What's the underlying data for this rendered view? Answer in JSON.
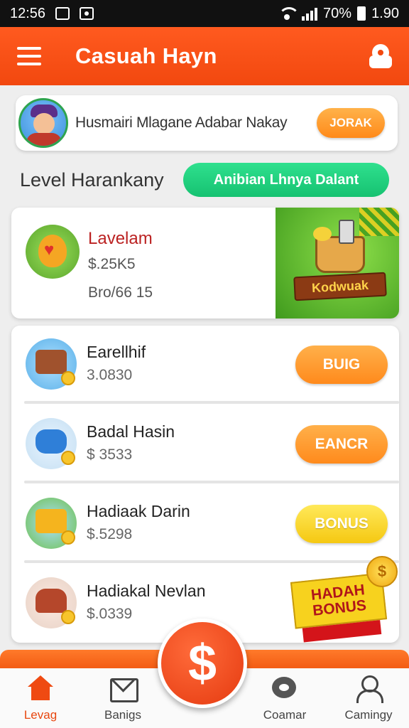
{
  "status_bar": {
    "time": "12:56",
    "battery_text": "70%",
    "clock_right": "1.90"
  },
  "header": {
    "title": "Casuah Hayn"
  },
  "user_card": {
    "text": "Husmairi Mlagane Adabar Nakay",
    "button_label": "JORAK"
  },
  "level_row": {
    "label": "Level Harankany",
    "action_label": "Anibian Lhnya Dalant"
  },
  "feature_card": {
    "title": "Lavelam",
    "value": "$.25K5",
    "subtitle": "Bro/66 15",
    "promo_text": "Kodwuak"
  },
  "list_items": [
    {
      "title": "Earellhif",
      "value": "3.0830",
      "button_label": "BUIG",
      "button_color": "#ff9a2a"
    },
    {
      "title": "Badal Hasin",
      "value": "$ 3533",
      "button_label": "EANCR",
      "button_color": "#ff9a2a"
    },
    {
      "title": "Hadiaak Darin",
      "value": "$.5298",
      "button_label": "BONUS",
      "button_color": "#f7d21e"
    },
    {
      "title": "Hadiakal Nevlan",
      "value": "$.0339",
      "banner_label": "HADAH BONUS",
      "coin_symbol": "$"
    }
  ],
  "fab": {
    "symbol": "$"
  },
  "bottom_nav": [
    {
      "label": "Levag",
      "icon": "home-icon",
      "active": true
    },
    {
      "label": "Banigs",
      "icon": "mail-icon",
      "active": false
    },
    {
      "label": "Coamar",
      "icon": "chat-icon",
      "active": false
    },
    {
      "label": "Camingy",
      "icon": "user-icon",
      "active": false
    }
  ],
  "colors": {
    "brand": "#f2480f",
    "accent_green": "#16c271"
  }
}
